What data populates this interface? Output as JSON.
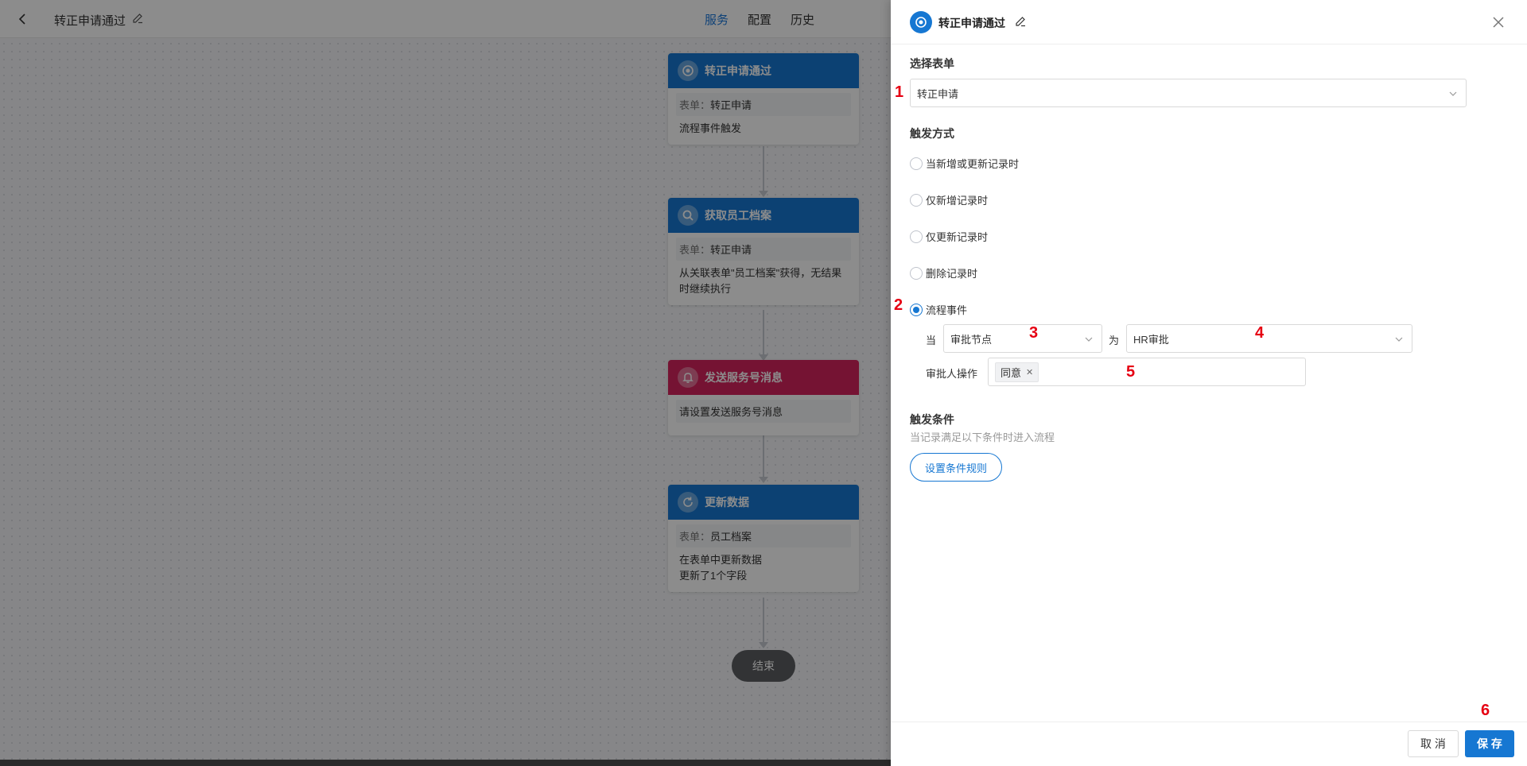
{
  "topbar": {
    "title": "转正申请通过",
    "tabs": [
      {
        "label": "服务",
        "active": true
      },
      {
        "label": "配置",
        "active": false
      },
      {
        "label": "历史",
        "active": false
      }
    ]
  },
  "flow": {
    "nodes": [
      {
        "title": "转正申请通过",
        "icon": "target-icon",
        "form_key": "表单：",
        "form_value": "转正申请",
        "desc": "流程事件触发"
      },
      {
        "title": "获取员工档案",
        "icon": "search-icon",
        "form_key": "表单：",
        "form_value": "转正申请",
        "desc": "从关联表单\"员工档案\"获得，无结果时继续执行"
      },
      {
        "title": "发送服务号消息",
        "icon": "bell-icon",
        "desc": "请设置发送服务号消息"
      },
      {
        "title": "更新数据",
        "icon": "refresh-icon",
        "form_key": "表单：",
        "form_value": "员工档案",
        "desc1": "在表单中更新数据",
        "desc2": "更新了1个字段"
      }
    ],
    "end_label": "结束"
  },
  "drawer": {
    "title": "转正申请通过",
    "select_form_label": "选择表单",
    "form_value": "转正申请",
    "trigger_label": "触发方式",
    "radios": [
      {
        "label": "当新增或更新记录时",
        "checked": false
      },
      {
        "label": "仅新增记录时",
        "checked": false
      },
      {
        "label": "仅更新记录时",
        "checked": false
      },
      {
        "label": "删除记录时",
        "checked": false
      },
      {
        "label": "流程事件",
        "checked": true
      }
    ],
    "when_label": "当",
    "node_type_value": "审批节点",
    "as_label": "为",
    "node_value": "HR审批",
    "approver_op_label": "审批人操作",
    "approver_op_tag": "同意",
    "condition_label": "触发条件",
    "condition_hint": "当记录满足以下条件时进入流程",
    "rule_button": "设置条件规则",
    "cancel": "取 消",
    "save": "保 存"
  },
  "markers": [
    "1",
    "2",
    "3",
    "4",
    "5",
    "6"
  ],
  "colors": {
    "primary": "#1677d2",
    "pink": "#d6245e",
    "marker": "#e60012"
  }
}
